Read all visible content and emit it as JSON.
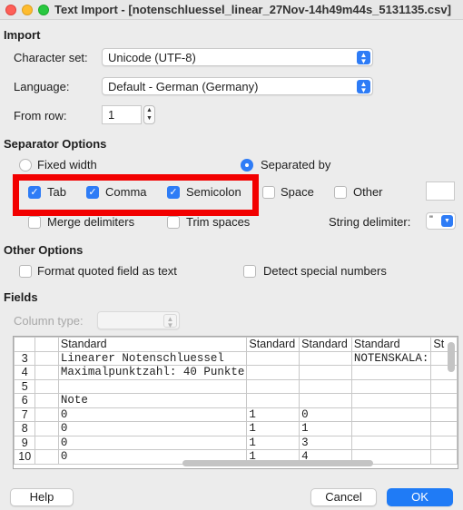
{
  "window": {
    "title": "Text Import - [notenschluessel_linear_27Nov-14h49m44s_5131135.csv]"
  },
  "import": {
    "heading": "Import",
    "charset_label": "Character set:",
    "charset_value": "Unicode (UTF-8)",
    "language_label": "Language:",
    "language_value": "Default - German (Germany)",
    "from_row_label": "From row:",
    "from_row_value": "1"
  },
  "separator": {
    "heading": "Separator Options",
    "fixed_width": "Fixed width",
    "separated_by": "Separated by",
    "tab": "Tab",
    "comma": "Comma",
    "semicolon": "Semicolon",
    "space": "Space",
    "other": "Other",
    "merge": "Merge delimiters",
    "trim": "Trim spaces",
    "string_delim_label": "String delimiter:",
    "string_delim_value": "\"",
    "highlight_color": "#f20000"
  },
  "other_options": {
    "heading": "Other Options",
    "format_quoted": "Format quoted field as text",
    "detect_special": "Detect special numbers"
  },
  "fields": {
    "heading": "Fields",
    "column_type_label": "Column type:",
    "column_type_value": "",
    "headers": [
      "Standard",
      "Standard",
      "Standard",
      "Standard",
      "St"
    ],
    "rows": [
      {
        "num": "3",
        "cells": [
          "Linearer Notenschluessel",
          "",
          "",
          "NOTENSKALA:",
          ""
        ]
      },
      {
        "num": "4",
        "cells": [
          "Maximalpunktzahl: 40 Punkte",
          "",
          "",
          "",
          ""
        ]
      },
      {
        "num": "5",
        "cells": [
          "",
          "",
          "",
          "",
          ""
        ]
      },
      {
        "num": "6",
        "cells": [
          "Note",
          "",
          "",
          "",
          ""
        ]
      },
      {
        "num": "7",
        "cells": [
          "0",
          "1",
          "0",
          "",
          ""
        ]
      },
      {
        "num": "8",
        "cells": [
          "0",
          "1",
          "1",
          "",
          ""
        ]
      },
      {
        "num": "9",
        "cells": [
          "0",
          "1",
          "3",
          "",
          ""
        ]
      },
      {
        "num": "10",
        "cells": [
          "0",
          "1",
          "4",
          "",
          ""
        ]
      }
    ]
  },
  "buttons": {
    "help": "Help",
    "cancel": "Cancel",
    "ok": "OK"
  },
  "colors": {
    "accent": "#2e7cf6",
    "primary_button": "#1f7bf6"
  }
}
